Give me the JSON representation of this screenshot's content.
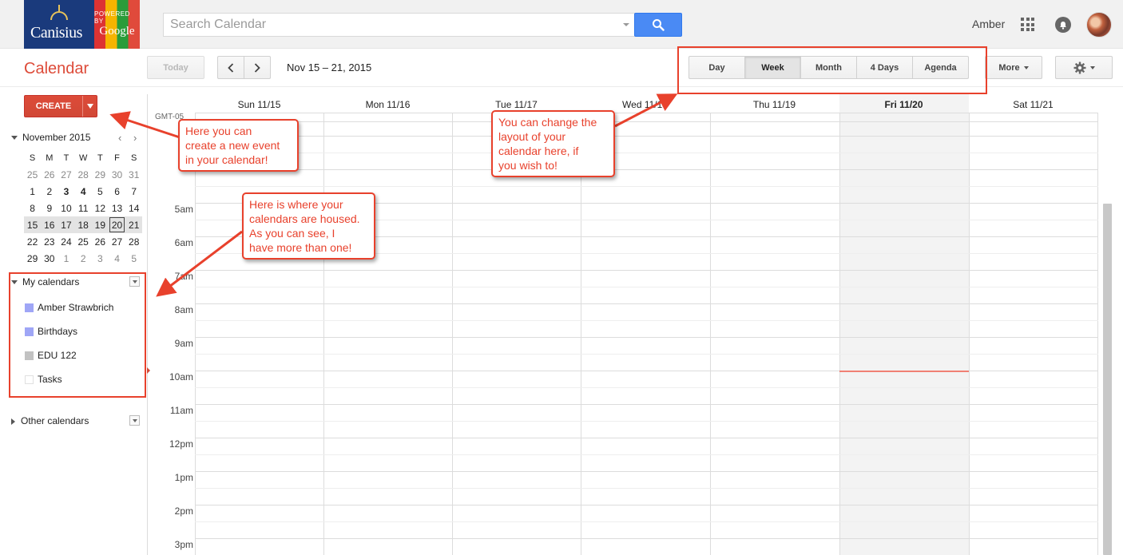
{
  "branding": {
    "logo_text": "Canisius",
    "powered_by": "POWERED BY",
    "google": "Google"
  },
  "search": {
    "placeholder": "Search Calendar",
    "value": ""
  },
  "user": {
    "name": "Amber"
  },
  "app": {
    "title": "Calendar"
  },
  "toolbar": {
    "today_label": "Today",
    "prev_label": "‹",
    "next_label": "›",
    "date_range": "Nov 15 – 21, 2015",
    "views": [
      {
        "label": "Day",
        "active": false
      },
      {
        "label": "Week",
        "active": true
      },
      {
        "label": "Month",
        "active": false
      },
      {
        "label": "4 Days",
        "active": false
      },
      {
        "label": "Agenda",
        "active": false
      }
    ],
    "more_label": "More"
  },
  "sidebar": {
    "create_label": "CREATE",
    "mini_calendar": {
      "month_label": "November 2015",
      "weekdays": [
        "S",
        "M",
        "T",
        "W",
        "T",
        "F",
        "S"
      ],
      "weeks": [
        [
          "25",
          "26",
          "27",
          "28",
          "29",
          "30",
          "31"
        ],
        [
          "1",
          "2",
          "3",
          "4",
          "5",
          "6",
          "7"
        ],
        [
          "8",
          "9",
          "10",
          "11",
          "12",
          "13",
          "14"
        ],
        [
          "15",
          "16",
          "17",
          "18",
          "19",
          "20",
          "21"
        ],
        [
          "22",
          "23",
          "24",
          "25",
          "26",
          "27",
          "28"
        ],
        [
          "29",
          "30",
          "1",
          "2",
          "3",
          "4",
          "5"
        ]
      ],
      "today": "20"
    },
    "my_calendars": {
      "label": "My calendars",
      "items": [
        {
          "name": "Amber Strawbrich",
          "color": "#9fa6f6"
        },
        {
          "name": "Birthdays",
          "color": "#9fa6f6"
        },
        {
          "name": "EDU 122",
          "color": "#c2c2c2"
        },
        {
          "name": "Tasks",
          "color": "#ffffff"
        }
      ]
    },
    "other_calendars": {
      "label": "Other calendars"
    }
  },
  "grid": {
    "timezone": "GMT-05",
    "days": [
      "Sun 11/15",
      "Mon 11/16",
      "Tue 11/17",
      "Wed 11/18",
      "Thu 11/19",
      "Fri 11/20",
      "Sat 11/21"
    ],
    "current_day_index": 5,
    "times": [
      "5am",
      "6am",
      "7am",
      "8am",
      "9am",
      "10am",
      "11am",
      "12pm",
      "1pm",
      "2pm",
      "3pm"
    ]
  },
  "annotations": {
    "create_note": "Here you can\ncreate a new event\nin your calendar!",
    "layout_note": "You can change the\nlayout of your\ncalendar here, if\nyou wish to!",
    "calendars_note": "Here is where your\ncalendars are housed.\nAs you can see, I\nhave more than one!"
  },
  "colors": {
    "accent": "#dd4b39",
    "annotation": "#e8412c",
    "search_button": "#4a8af4"
  }
}
